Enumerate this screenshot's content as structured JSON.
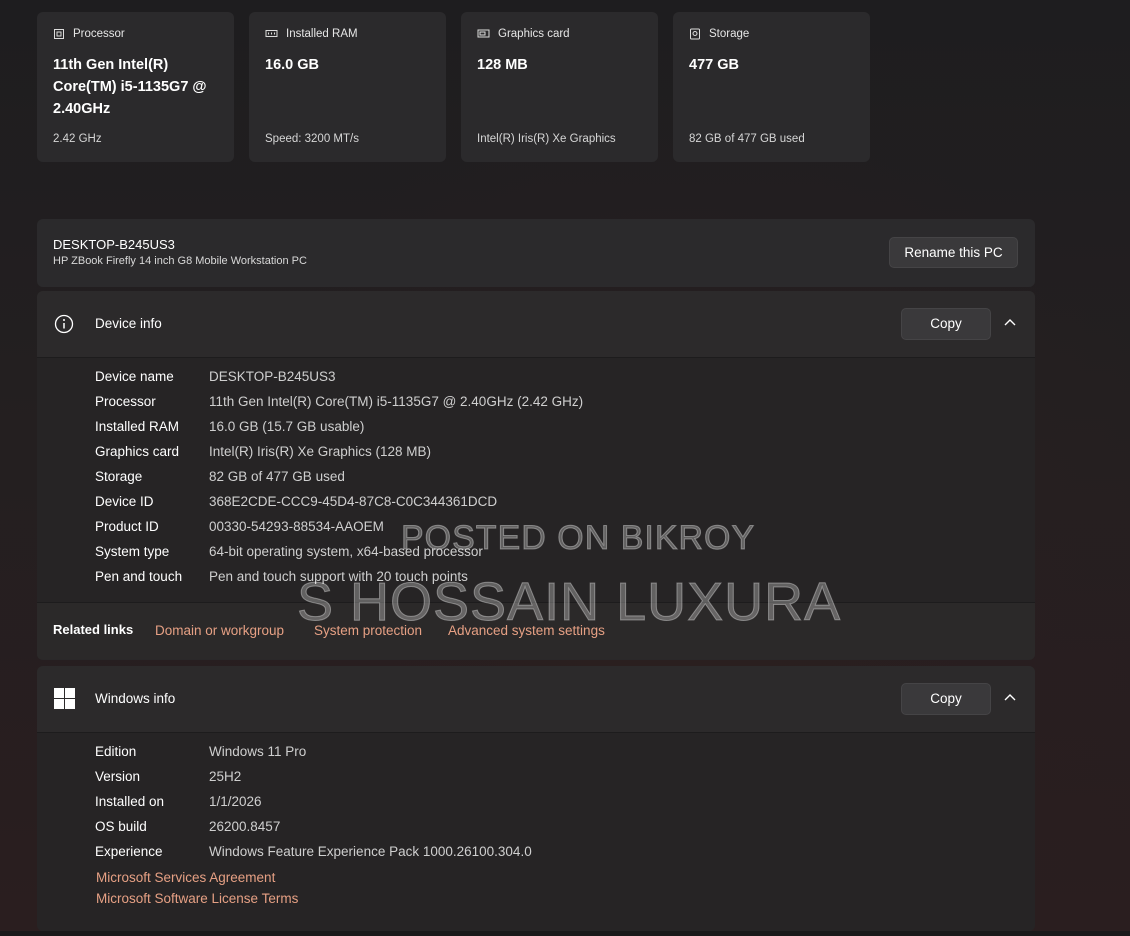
{
  "spec_cards": [
    {
      "icon": "processor-icon",
      "label": "Processor",
      "value_lines": [
        "11th Gen Intel(R)",
        "Core(TM) i5-1135G7 @",
        "2.40GHz"
      ],
      "sub": "2.42 GHz"
    },
    {
      "icon": "ram-icon",
      "label": "Installed RAM",
      "value_lines": [
        "16.0 GB"
      ],
      "sub": "Speed: 3200 MT/s"
    },
    {
      "icon": "graphics-card-icon",
      "label": "Graphics card",
      "value_lines": [
        "128 MB"
      ],
      "sub": "Intel(R) Iris(R) Xe Graphics"
    },
    {
      "icon": "storage-icon",
      "label": "Storage",
      "value_lines": [
        "477 GB"
      ],
      "sub": "82 GB of 477 GB used"
    }
  ],
  "pc": {
    "name": "DESKTOP-B245US3",
    "model": "HP ZBook Firefly 14 inch G8 Mobile Workstation PC",
    "rename_label": "Rename this PC"
  },
  "device_info": {
    "title": "Device info",
    "copy_label": "Copy",
    "rows": [
      {
        "key": "Device name",
        "value": "DESKTOP-B245US3"
      },
      {
        "key": "Processor",
        "value": "11th Gen Intel(R) Core(TM) i5-1135G7 @ 2.40GHz (2.42 GHz)"
      },
      {
        "key": "Installed RAM",
        "value": "16.0 GB (15.7 GB usable)"
      },
      {
        "key": "Graphics card",
        "value": "Intel(R) Iris(R) Xe Graphics (128 MB)"
      },
      {
        "key": "Storage",
        "value": "82 GB of 477 GB used"
      },
      {
        "key": "Device ID",
        "value": "368E2CDE-CCC9-45D4-87C8-C0C344361DCD"
      },
      {
        "key": "Product ID",
        "value": "00330-54293-88534-AAOEM"
      },
      {
        "key": "System type",
        "value": "64-bit operating system, x64-based processor"
      },
      {
        "key": "Pen and touch",
        "value": "Pen and touch support with 20 touch points"
      }
    ]
  },
  "related_links": {
    "label": "Related links",
    "links": [
      "Domain or workgroup",
      "System protection",
      "Advanced system settings"
    ]
  },
  "windows_info": {
    "title": "Windows info",
    "copy_label": "Copy",
    "rows": [
      {
        "key": "Edition",
        "value": "Windows 11 Pro"
      },
      {
        "key": "Version",
        "value": "25H2"
      },
      {
        "key": "Installed on",
        "value": "1/1/2026"
      },
      {
        "key": "OS build",
        "value": "26200.8457"
      },
      {
        "key": "Experience",
        "value": "Windows Feature Experience Pack 1000.26100.304.0"
      }
    ],
    "links": [
      "Microsoft Services Agreement",
      "Microsoft Software License Terms"
    ]
  },
  "watermark": {
    "line1": "POSTED ON BIKROY",
    "line2": "S HOSSAIN LUXURA"
  },
  "colors": {
    "link": "#e6a084",
    "card_bg": "#2b2a2c",
    "panel_bg": "#262425"
  }
}
